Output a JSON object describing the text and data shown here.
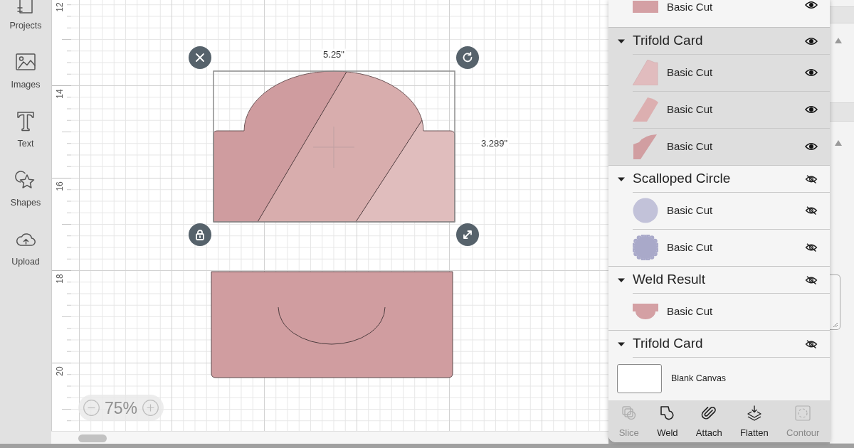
{
  "sidebar": {
    "items": [
      {
        "label": "Projects"
      },
      {
        "label": "Images"
      },
      {
        "label": "Text"
      },
      {
        "label": "Shapes"
      },
      {
        "label": "Upload"
      }
    ]
  },
  "ruler": {
    "labels": [
      "12",
      "14",
      "16",
      "18",
      "20"
    ]
  },
  "canvas": {
    "selection": {
      "width_text": "5.25\"",
      "height_text": "3.289\""
    },
    "zoom": "75%"
  },
  "layers": [
    {
      "kind": "layer",
      "label": "Basic Cut",
      "visible": true,
      "selected": false
    },
    {
      "kind": "group",
      "label": "Trifold Card",
      "visible": true,
      "selected": true,
      "expanded": true,
      "children": [
        {
          "label": "Basic Cut",
          "visible": true
        },
        {
          "label": "Basic Cut",
          "visible": true
        },
        {
          "label": "Basic Cut",
          "visible": true
        }
      ]
    },
    {
      "kind": "group",
      "label": "Scalloped Circle",
      "visible": false,
      "selected": false,
      "expanded": true,
      "children": [
        {
          "label": "Basic Cut",
          "visible": false
        },
        {
          "label": "Basic Cut",
          "visible": false
        }
      ]
    },
    {
      "kind": "group",
      "label": "Weld Result",
      "visible": false,
      "selected": false,
      "expanded": true,
      "children": [
        {
          "label": "Basic Cut"
        }
      ]
    },
    {
      "kind": "group",
      "label": "Trifold Card",
      "visible": false,
      "selected": false,
      "expanded": true
    }
  ],
  "blank_canvas": {
    "label": "Blank Canvas"
  },
  "tools": [
    {
      "label": "Slice",
      "disabled": true
    },
    {
      "label": "Weld",
      "disabled": false
    },
    {
      "label": "Attach",
      "disabled": false
    },
    {
      "label": "Flatten",
      "disabled": false
    },
    {
      "label": "Contour",
      "disabled": true
    }
  ]
}
